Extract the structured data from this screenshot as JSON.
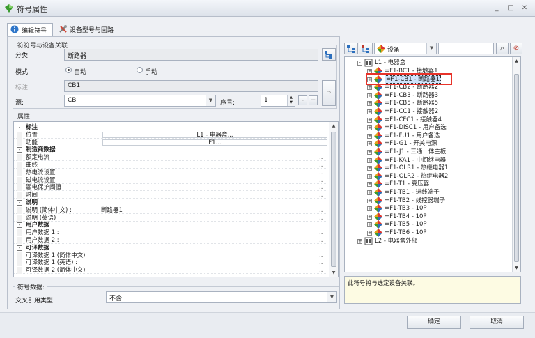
{
  "window": {
    "title": "符号属性"
  },
  "tabs": [
    {
      "label": "编辑符号"
    },
    {
      "label": "设备型号与回路"
    }
  ],
  "relation_group": {
    "title": "符符号与设备关联",
    "category_label": "分类:",
    "category_value": "断路器",
    "mode_label": "模式:",
    "mode_auto": "自动",
    "mode_manual": "手动",
    "tag_label": "标注:",
    "tag_value": "CB1",
    "source_label": "源:",
    "source_value": "CB",
    "seq_label": "序号:",
    "seq_value": "1",
    "minus": "-",
    "plus": "+"
  },
  "props_group": {
    "title": "属性",
    "rows": [
      {
        "type": "cat",
        "name": "标注"
      },
      {
        "type": "sub",
        "name": "位置",
        "box": "L1 - 电器盒..."
      },
      {
        "type": "sub",
        "name": "功能",
        "box": "F1..."
      },
      {
        "type": "cat",
        "name": "制造商数据"
      },
      {
        "type": "sub",
        "name": "额定电流",
        "dots": ".."
      },
      {
        "type": "sub",
        "name": "曲线",
        "dots": ".."
      },
      {
        "type": "sub",
        "name": "热电流设置",
        "dots": ".."
      },
      {
        "type": "sub",
        "name": "磁电流设置",
        "dots": ".."
      },
      {
        "type": "sub",
        "name": "漏电保护阈值",
        "dots": ".."
      },
      {
        "type": "sub",
        "name": "时间",
        "dots": ".."
      },
      {
        "type": "cat",
        "name": "说明"
      },
      {
        "type": "sub",
        "name": "说明 (简体中文) :",
        "val": "断路器1",
        "dots": ".."
      },
      {
        "type": "sub",
        "name": "说明 (英语) :",
        "dots": ".."
      },
      {
        "type": "cat",
        "name": "用户数据"
      },
      {
        "type": "sub",
        "name": "用户数据 1 :",
        "dots": ".."
      },
      {
        "type": "sub",
        "name": "用户数据 2 :",
        "dots": ".."
      },
      {
        "type": "cat",
        "name": "可译数据"
      },
      {
        "type": "sub",
        "name": "可译数据 1 (简体中文) :",
        "dots": ".."
      },
      {
        "type": "sub",
        "name": "可译数据 1 (英语) :",
        "dots": ".."
      },
      {
        "type": "sub",
        "name": "可译数据 2 (简体中文) :",
        "dots": ".."
      }
    ]
  },
  "symbol_data_group": {
    "title": "符号数据:",
    "crossref_label": "交叉引用类型:",
    "crossref_value": "不含"
  },
  "tree_toolbar": {
    "device_select": "设备",
    "search_value": ""
  },
  "tree": {
    "root": {
      "label": "L1 - 电器盒",
      "expanded": true
    },
    "items": [
      "=F1-BC1 - 接触器1",
      "=F1-CB1 - 断路器1",
      "=F1-CB2 - 断路器2",
      "=F1-CB3 - 断路器3",
      "=F1-CB5 - 断路器5",
      "=F1-CC1 - 接触器2",
      "=F1-CFC1 - 接触器4",
      "=F1-DISC1 - 用户备选",
      "=F1-FU1 - 用户备选",
      "=F1-G1 - 开关电源",
      "=F1-J1 - 三通一体主板",
      "=F1-KA1 - 中间继电器",
      "=F1-OLR1 - 热继电器1",
      "=F1-OLR2 - 热继电器2",
      "=F1-T1 - 变压器",
      "=F1-TB1 - 进线端子",
      "=F1-TB2 - 线控器端子",
      "=F1-TB3 - 10P",
      "=F1-TB4 - 10P",
      "=F1-TB5 - 10P",
      "=F1-TB6 - 10P"
    ],
    "selected_index": 1,
    "root2": {
      "label": "L2 - 电器盒外部",
      "expanded": false
    }
  },
  "description": "此符号将与选定设备关联。",
  "footer": {
    "ok": "确定",
    "cancel": "取消"
  },
  "colors": {
    "highlight_box": "#e8332a",
    "selection": "#cfe3fb"
  }
}
